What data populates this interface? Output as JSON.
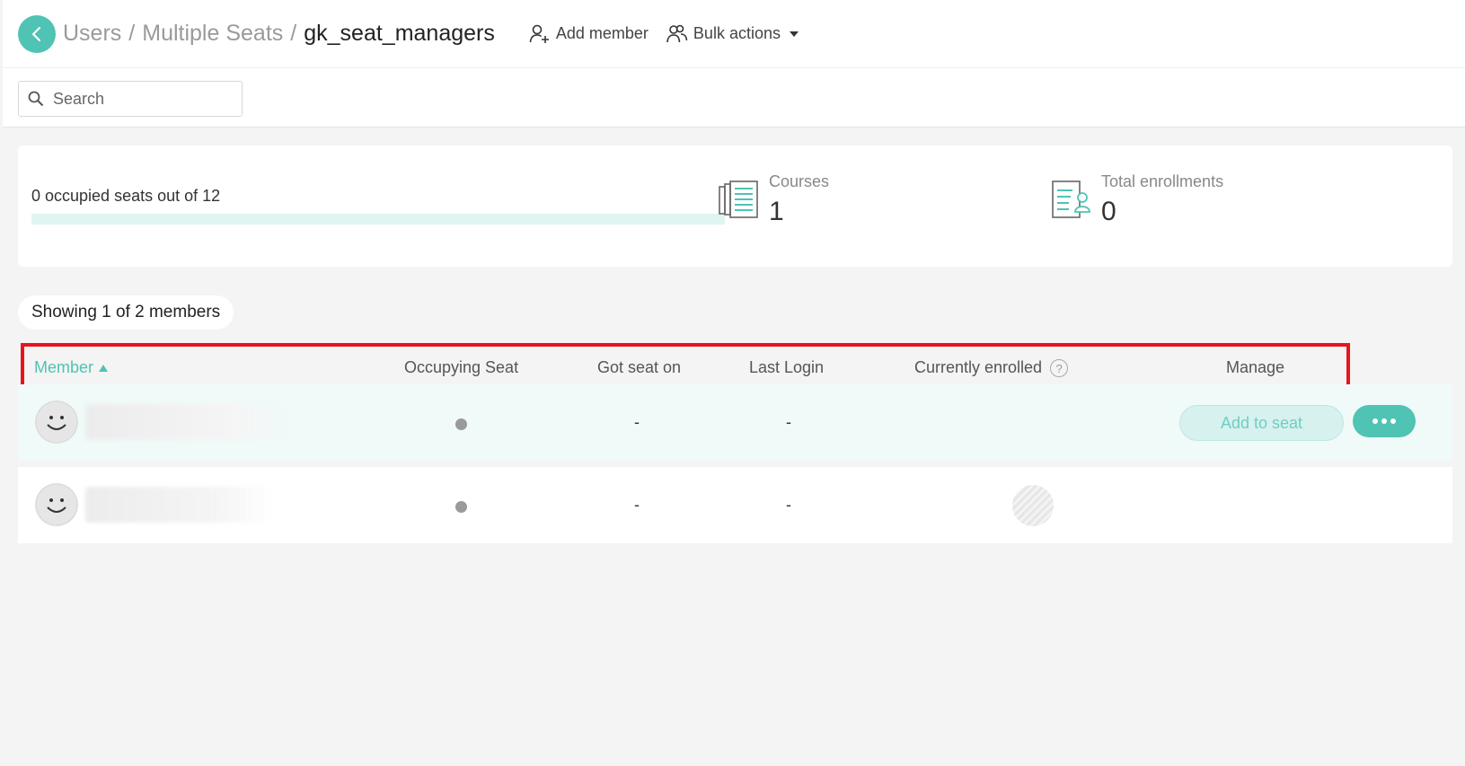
{
  "breadcrumb": {
    "items": [
      "Users",
      "Multiple Seats"
    ],
    "separator": "/",
    "current": "gk_seat_managers"
  },
  "actions": {
    "add_member": "Add member",
    "bulk_actions": "Bulk actions"
  },
  "search": {
    "placeholder": "Search"
  },
  "stats": {
    "seats_text": "0 occupied seats out of 12",
    "seats_occupied_fraction": 0,
    "courses_label": "Courses",
    "courses_value": "1",
    "enrollments_label": "Total enrollments",
    "enrollments_value": "0"
  },
  "showing": "Showing 1 of 2 members",
  "table": {
    "headers": {
      "member": "Member",
      "occupying_seat": "Occupying Seat",
      "got_seat_on": "Got seat on",
      "last_login": "Last Login",
      "currently_enrolled": "Currently enrolled",
      "help": "?",
      "manage": "Manage"
    },
    "rows": [
      {
        "got_seat_on": "-",
        "last_login": "-",
        "add_to_seat": "Add to seat"
      },
      {
        "got_seat_on": "-",
        "last_login": "-"
      }
    ]
  },
  "colors": {
    "accent": "#4fc3b4",
    "highlight": "#e8141e"
  },
  "icons": [
    "chevron-left-icon",
    "add-user-icon",
    "users-icon",
    "caret-down-icon",
    "search-icon",
    "courses-icon",
    "enrollments-icon",
    "sort-asc-icon",
    "help-icon",
    "smiley-avatar-icon",
    "more-icon"
  ]
}
